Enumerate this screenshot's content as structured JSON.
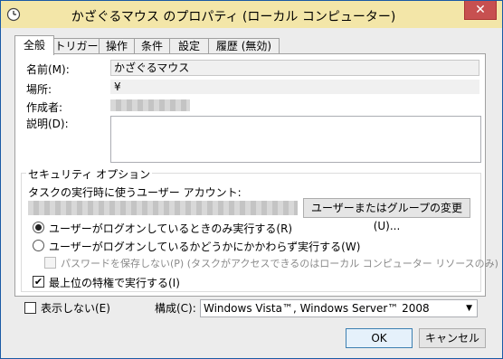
{
  "window": {
    "title": "かざぐるマウス のプロパティ (ローカル コンピューター)",
    "close_label": "✕"
  },
  "tabs": [
    "全般",
    "トリガー",
    "操作",
    "条件",
    "設定",
    "履歴 (無効)"
  ],
  "general": {
    "name_label": "名前(M):",
    "name_value": "かざぐるマウス",
    "location_label": "場所:",
    "location_value": "¥",
    "author_label": "作成者:",
    "description_label": "説明(D):"
  },
  "security": {
    "group_title": "セキュリティ オプション",
    "account_label": "タスクの実行時に使うユーザー アカウント:",
    "change_user_button": "ユーザーまたはグループの変更(U)...",
    "radio_logged_on": "ユーザーがログオンしているときのみ実行する(R)",
    "radio_whether": "ユーザーがログオンしているかどうかにかかわらず実行する(W)",
    "no_store_password": "パスワードを保存しない(P) (タスクがアクセスできるのはローカル コンピューター リソースのみ)",
    "highest_privileges": "最上位の特権で実行する(I)",
    "radio_selected": "logged_on",
    "highest_checked": true
  },
  "bottom": {
    "hidden_label": "表示しない(E)",
    "hidden_checked": false,
    "configure_label": "構成(C):",
    "configure_value": "Windows Vista™, Windows Server™ 2008"
  },
  "buttons": {
    "ok": "OK",
    "cancel": "キャンセル"
  }
}
